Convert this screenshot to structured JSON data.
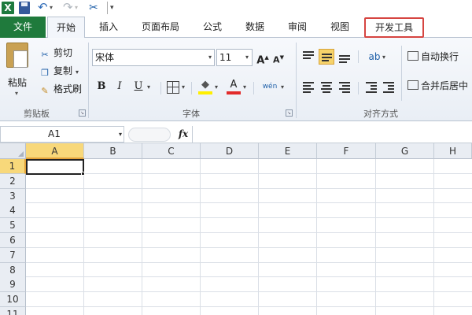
{
  "colors": {
    "file_tab": "#1f7a3c",
    "dev_highlight": "#d64541",
    "selected_header": "#f8d87a",
    "active_align": "#f6d36a"
  },
  "qat": {
    "logo": "X",
    "icons": [
      "excel-logo-icon",
      "save-icon",
      "undo-icon",
      "redo-icon",
      "customize-icon"
    ]
  },
  "tabs": {
    "file": "文件",
    "home": "开始",
    "insert": "插入",
    "page_layout": "页面布局",
    "formulas": "公式",
    "data": "数据",
    "review": "审阅",
    "view": "视图",
    "developer": "开发工具"
  },
  "clipboard": {
    "paste": "粘贴",
    "cut": "剪切",
    "copy": "复制",
    "format_painter": "格式刷",
    "group": "剪贴板"
  },
  "font": {
    "name": "宋体",
    "size": "11",
    "grow": "A",
    "shrink": "A",
    "bold": "B",
    "italic": "I",
    "underline": "U",
    "font_color": "A",
    "phonetic": "wén",
    "group": "字体"
  },
  "alignment": {
    "wrap_text": "自动换行",
    "merge_center": "合并后居中",
    "group": "对齐方式"
  },
  "formula_bar": {
    "name_box": "A1",
    "fx": "fx",
    "value": ""
  },
  "sheet": {
    "columns": [
      "A",
      "B",
      "C",
      "D",
      "E",
      "F",
      "G",
      "H"
    ],
    "rows": [
      "1",
      "2",
      "3",
      "4",
      "5",
      "6",
      "7",
      "8",
      "9",
      "10",
      "11"
    ],
    "active_cell": "A1"
  }
}
